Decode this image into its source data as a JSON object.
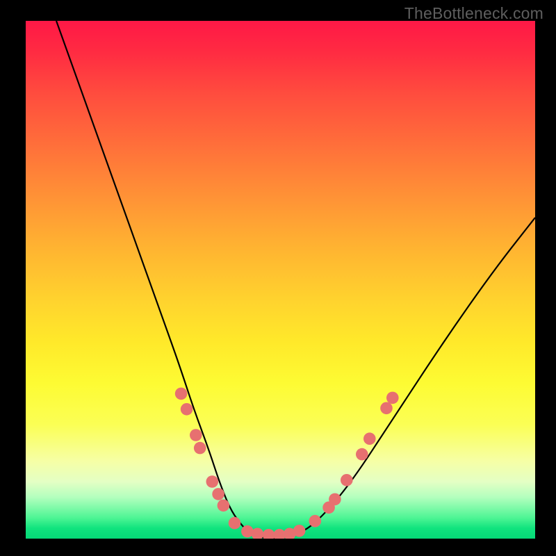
{
  "watermark": "TheBottleneck.com",
  "chart_data": {
    "type": "line",
    "title": "",
    "xlabel": "",
    "ylabel": "",
    "xlim": [
      0,
      100
    ],
    "ylim": [
      0,
      100
    ],
    "grid": false,
    "legend": false,
    "series": [
      {
        "name": "bottleneck-curve",
        "color": "#000000",
        "x": [
          6,
          10,
          14,
          18,
          22,
          26,
          30,
          33,
          36,
          38,
          40,
          42,
          44,
          47,
          50,
          54,
          58,
          64,
          72,
          82,
          92,
          100
        ],
        "y": [
          100,
          89,
          78,
          67,
          56,
          45,
          34,
          25,
          17,
          11,
          6,
          3,
          1,
          0,
          0,
          1,
          4,
          11,
          23,
          38,
          52,
          62
        ]
      }
    ],
    "markers": {
      "color": "#e77070",
      "radius_frac": 0.012,
      "points": [
        {
          "x": 30.5,
          "y": 28.0
        },
        {
          "x": 31.6,
          "y": 25.0
        },
        {
          "x": 33.4,
          "y": 20.0
        },
        {
          "x": 34.2,
          "y": 17.5
        },
        {
          "x": 36.6,
          "y": 11.0
        },
        {
          "x": 37.8,
          "y": 8.6
        },
        {
          "x": 38.8,
          "y": 6.4
        },
        {
          "x": 41.0,
          "y": 3.0
        },
        {
          "x": 43.5,
          "y": 1.4
        },
        {
          "x": 45.5,
          "y": 0.9
        },
        {
          "x": 47.7,
          "y": 0.7
        },
        {
          "x": 49.8,
          "y": 0.7
        },
        {
          "x": 51.8,
          "y": 0.9
        },
        {
          "x": 53.7,
          "y": 1.5
        },
        {
          "x": 56.8,
          "y": 3.4
        },
        {
          "x": 59.5,
          "y": 6.0
        },
        {
          "x": 60.7,
          "y": 7.6
        },
        {
          "x": 63.0,
          "y": 11.3
        },
        {
          "x": 66.0,
          "y": 16.3
        },
        {
          "x": 67.5,
          "y": 19.3
        },
        {
          "x": 70.8,
          "y": 25.2
        },
        {
          "x": 72.0,
          "y": 27.2
        }
      ]
    }
  }
}
